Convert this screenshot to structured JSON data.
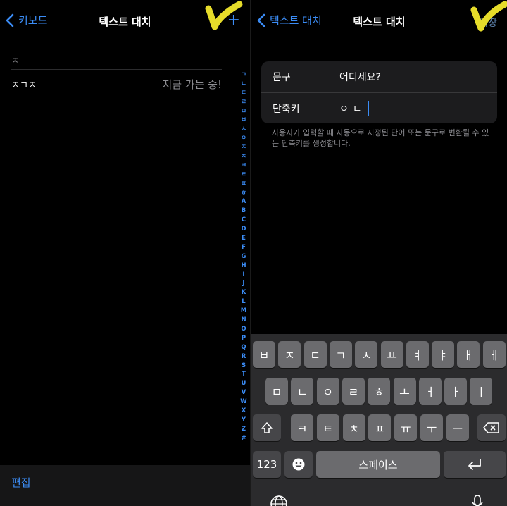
{
  "left": {
    "back_label": "키보드",
    "title": "텍스트 대치",
    "add_glyph": "+",
    "section_header": "ㅈ",
    "rows": [
      {
        "shortcut": "ㅈㄱㅈ",
        "phrase": "지금 가는 중!"
      }
    ],
    "index_letters": [
      "ㄱ",
      "ㄴ",
      "ㄷ",
      "ㄹ",
      "ㅁ",
      "ㅂ",
      "ㅅ",
      "ㅇ",
      "ㅈ",
      "ㅊ",
      "ㅋ",
      "ㅌ",
      "ㅍ",
      "ㅎ",
      "A",
      "B",
      "C",
      "D",
      "E",
      "F",
      "G",
      "H",
      "I",
      "J",
      "K",
      "L",
      "M",
      "N",
      "O",
      "P",
      "Q",
      "R",
      "S",
      "T",
      "U",
      "V",
      "W",
      "X",
      "Y",
      "Z",
      "#"
    ],
    "edit_label": "편집"
  },
  "right": {
    "back_label": "텍스트 대치",
    "title": "텍스트 대치",
    "save_label": "저장",
    "phrase_label": "문구",
    "phrase_value": "어디세요?",
    "shortcut_label": "단축키",
    "shortcut_value": "ㅇㄷ",
    "help_text": "사용자가 입력할 때 자동으로 지정된 단어 또는 문구로 변환될 수 있는 단축키를 생성합니다."
  },
  "keyboard": {
    "row1": [
      "ㅂ",
      "ㅈ",
      "ㄷ",
      "ㄱ",
      "ㅅ",
      "ㅛ",
      "ㅕ",
      "ㅑ",
      "ㅐ",
      "ㅔ"
    ],
    "row2": [
      "ㅁ",
      "ㄴ",
      "ㅇ",
      "ㄹ",
      "ㅎ",
      "ㅗ",
      "ㅓ",
      "ㅏ",
      "ㅣ"
    ],
    "row3": [
      "ㅋ",
      "ㅌ",
      "ㅊ",
      "ㅍ",
      "ㅠ",
      "ㅜ",
      "ㅡ"
    ],
    "numbers_label": "123",
    "space_label": "스페이스"
  },
  "colors": {
    "accent": "#3b8cf5",
    "checkmark": "#e6dc2a",
    "key": "#6b6b6e",
    "key_dark": "#464649"
  }
}
